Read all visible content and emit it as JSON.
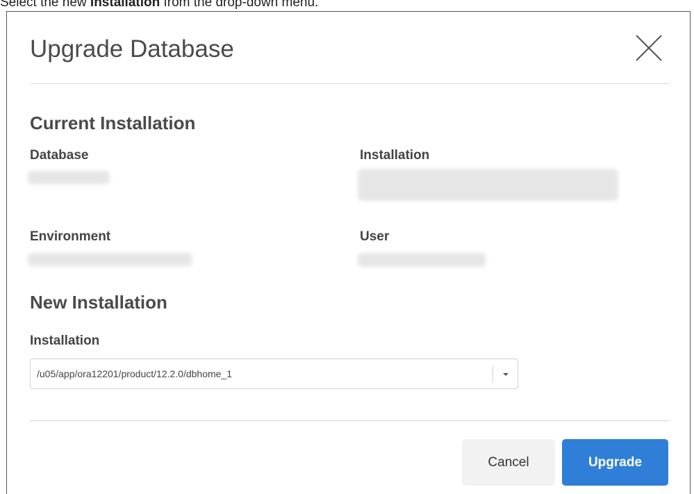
{
  "instruction": {
    "prefix": "Select the new ",
    "bold": "Installation",
    "suffix": " from the drop-down menu."
  },
  "dialog": {
    "title": "Upgrade Database",
    "close_icon": "close-icon"
  },
  "current_installation": {
    "heading": "Current Installation",
    "database_label": "Database",
    "installation_label": "Installation",
    "environment_label": "Environment",
    "user_label": "User"
  },
  "new_installation": {
    "heading": "New Installation",
    "installation_label": "Installation",
    "installation_value": "/u05/app/ora12201/product/12.2.0/dbhome_1"
  },
  "footer": {
    "cancel_label": "Cancel",
    "upgrade_label": "Upgrade"
  },
  "colors": {
    "primary_button": "#2f7fd9",
    "secondary_button": "#f2f2f2"
  }
}
